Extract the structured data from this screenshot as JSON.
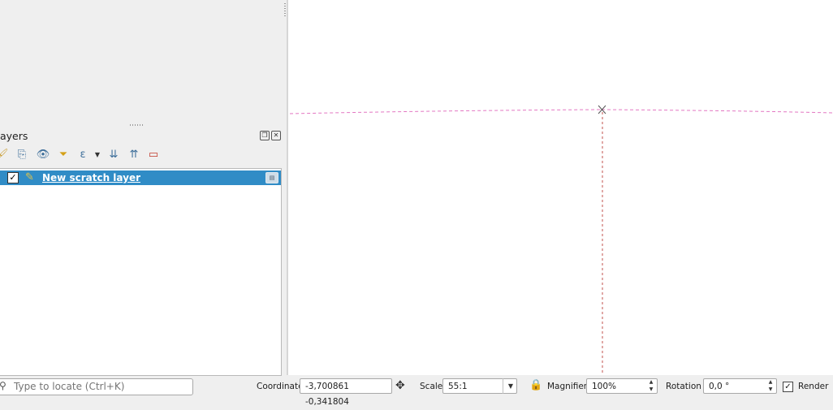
{
  "layers_panel": {
    "title": "ayers",
    "float_btn": "❐",
    "close_btn": "✕",
    "toolbar": [
      {
        "name": "style-icon",
        "glyph": "🖌"
      },
      {
        "name": "add-group-icon",
        "glyph": "⎘"
      },
      {
        "name": "visibility-eye-icon",
        "glyph": "👁"
      },
      {
        "name": "filter-icon",
        "glyph": "⏷"
      },
      {
        "name": "expression-filter-icon",
        "glyph": "ε"
      },
      {
        "name": "expand-all-icon",
        "glyph": "⇊"
      },
      {
        "name": "collapse-all-icon",
        "glyph": "⇈"
      },
      {
        "name": "remove-layer-icon",
        "glyph": "▭"
      }
    ],
    "layers": [
      {
        "name": "New scratch layer",
        "checked": "✓",
        "icon": "✎",
        "indicator": "▤"
      }
    ]
  },
  "map": {
    "crosshair_color": "#e377c2",
    "vertical_line_color": "#c0504d"
  },
  "status_bar": {
    "locator_placeholder": "Type to locate (Ctrl+K)",
    "coordinate_label": "Coordinate",
    "coordinate_value": "-3,700861 -0,341804",
    "scale_label": "Scale",
    "scale_value": "55:1",
    "magnifier_label": "Magnifier",
    "magnifier_value": "100%",
    "rotation_label": "Rotation",
    "rotation_value": "0,0 °",
    "render_label": "Render",
    "render_checked": "✓"
  }
}
